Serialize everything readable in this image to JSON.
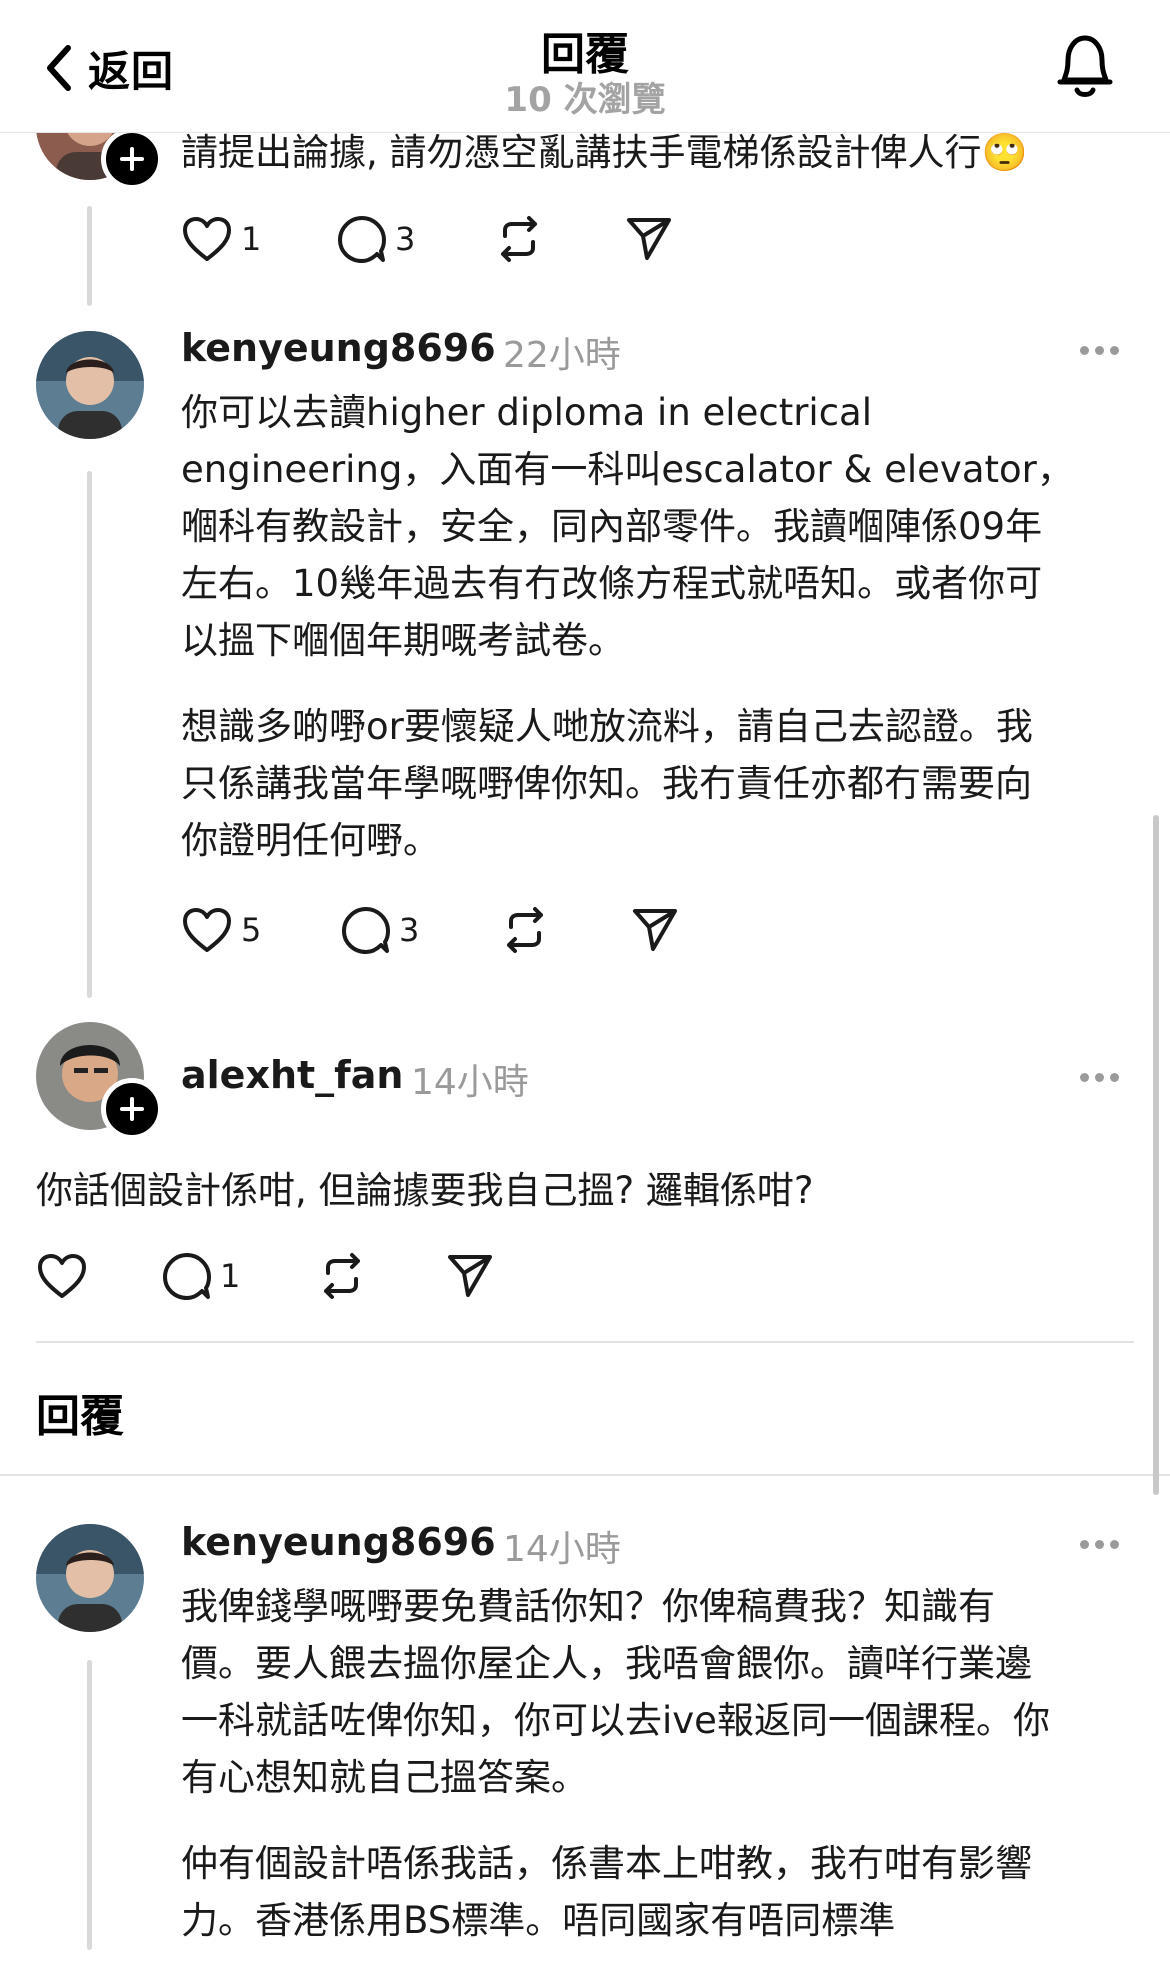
{
  "header": {
    "back_label": "返回",
    "title": "回覆",
    "subtitle": "10 次瀏覽"
  },
  "top_reply": {
    "text": "請提出論據, 請勿憑空亂講扶手電梯係設計俾人行🙄",
    "likes": "1",
    "comments": "3"
  },
  "post_ken_1": {
    "username": "kenyeung8696",
    "time": "22小時",
    "paragraphs": [
      [
        "你可以去讀higher diploma in electrical",
        "engineering，入面有一科叫escalator & elevator，",
        "嗰科有教設計，安全，同內部零件。我讀嗰陣係09年",
        "左右。10幾年過去有冇改條方程式就唔知。或者你可",
        "以搵下嗰個年期嘅考試卷。"
      ],
      [
        "想識多啲嘢or要懷疑人哋放流料，請自己去認證。我",
        "只係講我當年學嘅嘢俾你知。我冇責任亦都冇需要向",
        "你證明任何嘢。"
      ]
    ],
    "likes": "5",
    "comments": "3"
  },
  "post_alex": {
    "username": "alexht_fan",
    "time": "14小時",
    "text": "你話個設計係咁, 但論據要我自己搵? 邏輯係咁?",
    "comments": "1"
  },
  "replies_heading": "回覆",
  "post_ken_2": {
    "username": "kenyeung8696",
    "time": "14小時",
    "paragraphs": [
      [
        "我俾錢學嘅嘢要免費話你知？你俾稿費我？知識有",
        "價。要人餵去搵你屋企人，我唔會餵你。讀咩行業邊",
        "一科就話咗俾你知，你可以去ive報返同一個課程。你",
        "有心想知就自己搵答案。"
      ],
      [
        "仲有個設計唔係我話，係書本上咁教，我冇咁有影響",
        "力。香港係用BS標準。唔同國家有唔同標準"
      ]
    ]
  },
  "icons": {
    "back": "chevron-left-icon",
    "bell": "bell-icon",
    "like": "heart-icon",
    "comment": "comment-bubble-icon",
    "repost": "repost-icon",
    "share": "send-icon",
    "more": "more-dots-icon",
    "follow": "plus-icon"
  }
}
